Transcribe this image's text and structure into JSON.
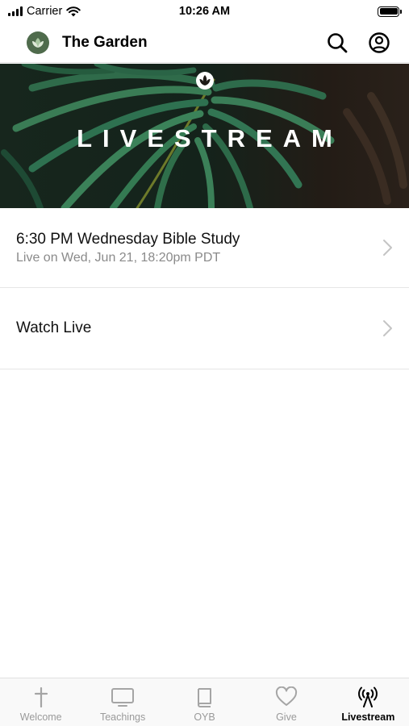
{
  "status_bar": {
    "carrier": "Carrier",
    "time": "10:26 AM"
  },
  "header": {
    "title": "The Garden",
    "icons": [
      "search-icon",
      "account-icon"
    ]
  },
  "hero": {
    "title": "LIVESTREAM",
    "background": "palm-leaf-photo"
  },
  "list": {
    "items": [
      {
        "title": "6:30 PM Wednesday Bible Study",
        "subtitle": "Live on Wed, Jun 21, 18:20pm PDT"
      },
      {
        "title": "Watch Live",
        "subtitle": ""
      }
    ]
  },
  "tabbar": {
    "tabs": [
      {
        "label": "Welcome",
        "icon": "cross-icon",
        "active": false
      },
      {
        "label": "Teachings",
        "icon": "tv-icon",
        "active": false
      },
      {
        "label": "OYB",
        "icon": "book-icon",
        "active": false
      },
      {
        "label": "Give",
        "icon": "heart-icon",
        "active": false
      },
      {
        "label": "Livestream",
        "icon": "broadcast-icon",
        "active": true
      }
    ]
  },
  "colors": {
    "active_tab": "#000000",
    "inactive_tab": "#9a9a9a",
    "logo_green": "#4f6b4c",
    "hero_dark": "#1e1b17",
    "subtitle_gray": "#8a8a8a"
  }
}
